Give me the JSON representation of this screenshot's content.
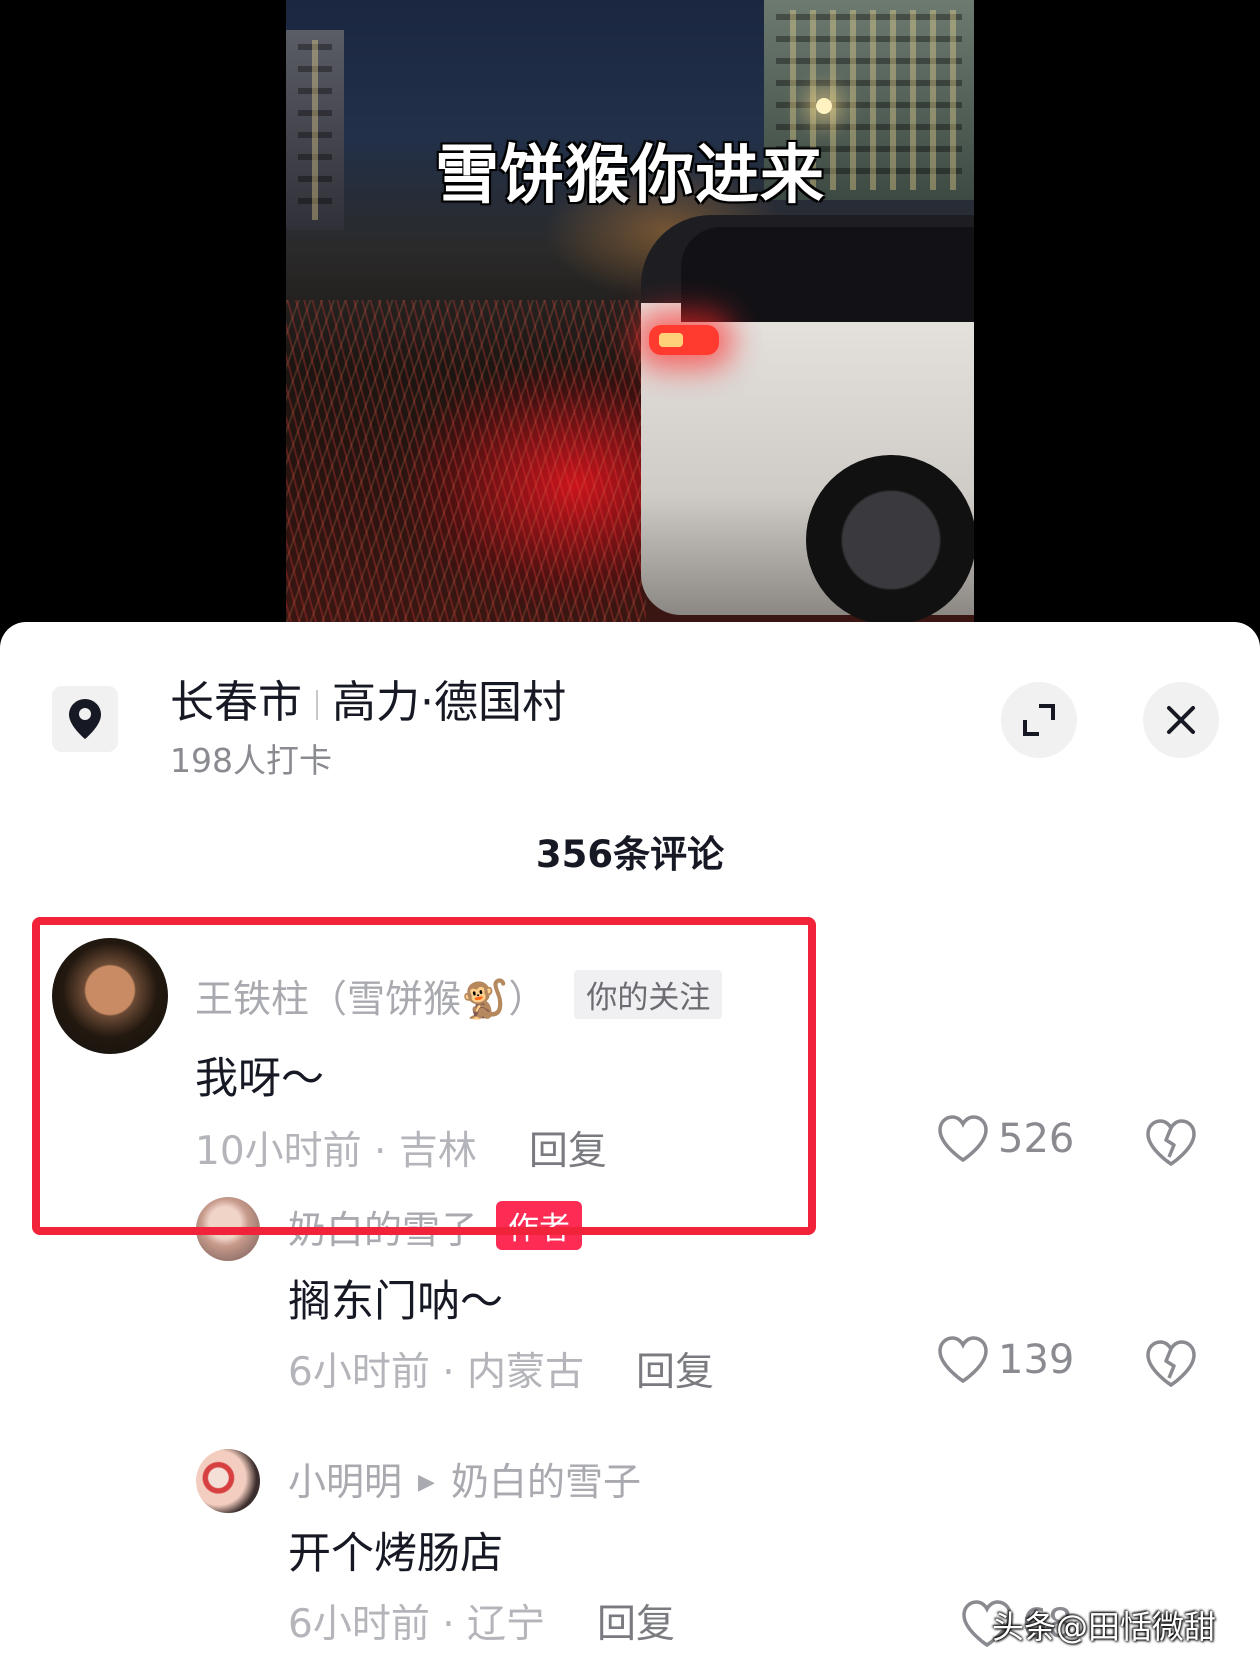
{
  "video": {
    "caption": "雪饼猴你进来"
  },
  "location": {
    "city": "长春市",
    "place": "高力·德国村",
    "checkins": "198人打卡",
    "icon": "location-pin-icon"
  },
  "header": {
    "comment_count": "356条评论",
    "expand_icon": "expand-icon",
    "close_icon": "close-icon"
  },
  "comments": [
    {
      "author": "王铁柱（雪饼猴🐒）",
      "badge": "你的关注",
      "text": "我呀～",
      "time": "10小时前",
      "region": "吉林",
      "reply_label": "回复",
      "likes": "526"
    },
    {
      "author": "奶白的雪子",
      "badge": "作者",
      "text": "搁东门呐～",
      "time": "6小时前",
      "region": "内蒙古",
      "reply_label": "回复",
      "likes": "139"
    },
    {
      "author": "小明明",
      "reply_to": "奶白的雪子",
      "text": "开个烤肠店",
      "time": "6小时前",
      "region": "辽宁",
      "reply_label": "回复",
      "likes": "68"
    }
  ],
  "meta_separator": " · ",
  "colors": {
    "highlight_box": "#f0233a",
    "author_badge": "#fe2c55"
  },
  "watermark": "头条@田恬微甜"
}
